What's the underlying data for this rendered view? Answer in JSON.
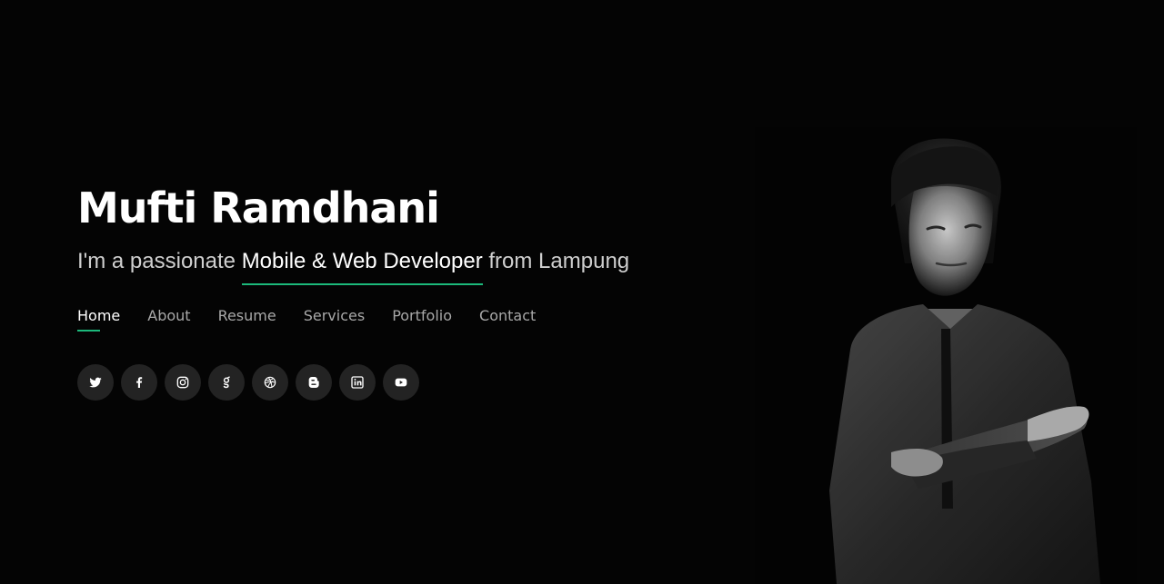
{
  "hero": {
    "name": "Mufti Ramdhani",
    "tagline_prefix": "I'm a passionate ",
    "tagline_role": "Mobile & Web Developer",
    "tagline_suffix": " from Lampung"
  },
  "nav": {
    "items": [
      {
        "label": "Home",
        "active": true
      },
      {
        "label": "About"
      },
      {
        "label": "Resume"
      },
      {
        "label": "Services"
      },
      {
        "label": "Portfolio"
      },
      {
        "label": "Contact"
      }
    ]
  },
  "social": {
    "icons": [
      "twitter-icon",
      "facebook-icon",
      "instagram-icon",
      "google-plus-icon",
      "dribbble-icon",
      "blogger-icon",
      "linkedin-icon",
      "youtube-icon"
    ]
  },
  "colors": {
    "background": "#040404",
    "accent": "#1cb97b",
    "text_primary": "#ffffff",
    "text_muted": "#a8a8a8",
    "icon_bg": "#232323"
  }
}
